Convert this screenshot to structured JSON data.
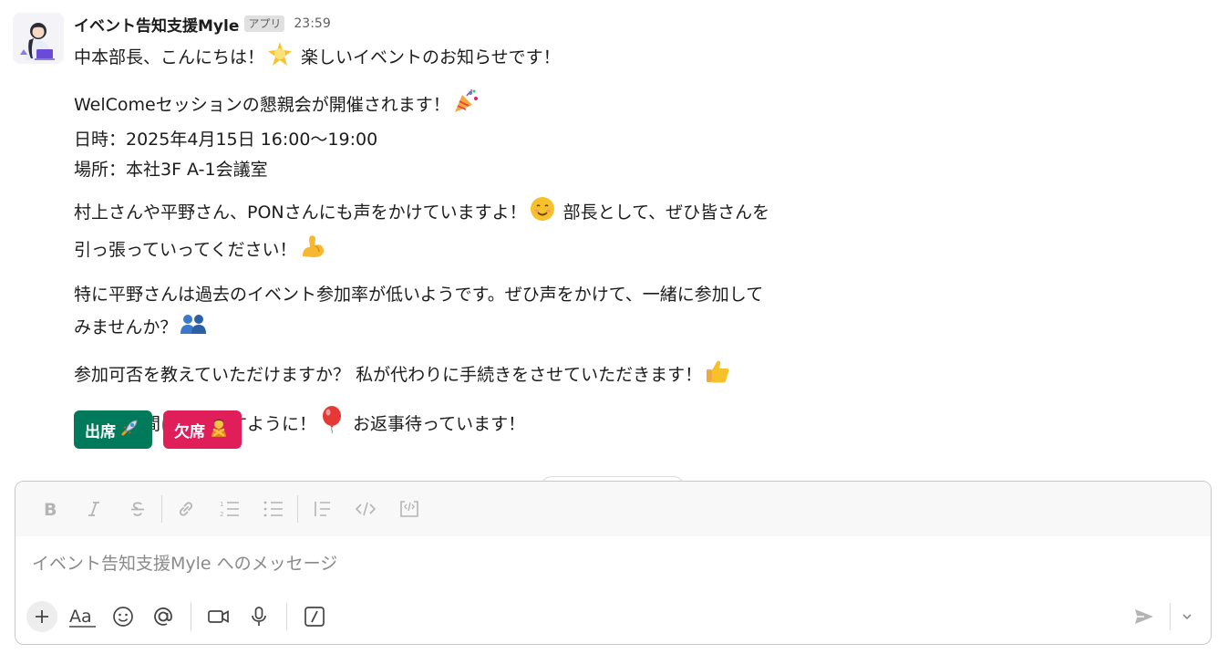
{
  "message": {
    "sender": "イベント告知支援Myle",
    "badge": "アプリ",
    "time": "23:59",
    "avatar_icon": "woman-with-laptop-avatar",
    "paragraphs": [
      {
        "lines": [
          {
            "pre": "中本部長、こんにちは！",
            "emoji": "glowing-star-emoji",
            "post": " 楽しいイベントのお知らせです！"
          }
        ]
      },
      {
        "lines": [
          {
            "pre": "WelComeセッションの懇親会が開催されます！",
            "emoji": "party-popper-emoji",
            "post": ""
          },
          {
            "pre": "日時：2025年4月15日 16:00〜19:00",
            "emoji": "",
            "post": ""
          },
          {
            "pre": "場所：本社3F A-1会議室",
            "emoji": "",
            "post": ""
          }
        ]
      },
      {
        "lines": [
          {
            "pre": "村上さんや平野さん、PONさんにも声をかけていますよ！",
            "emoji": "smiling-face-emoji",
            "post": " 部長として、ぜひ皆さんを"
          },
          {
            "pre": "引っ張っていってください！",
            "emoji": "flexed-biceps-emoji",
            "post": ""
          }
        ]
      },
      {
        "lines": [
          {
            "pre": "特に平野さんは過去のイベント参加率が低いようです。ぜひ声をかけて、一緒に参加して",
            "emoji": "",
            "post": ""
          },
          {
            "pre": "みませんか？",
            "emoji": "two-people-emoji",
            "post": ""
          }
        ]
      },
      {
        "lines": [
          {
            "pre": "参加可否を教えていただけますか？ 私が代わりに手続きをさせていただきます！",
            "emoji": "thumbs-up-emoji",
            "post": ""
          }
        ]
      },
      {
        "lines": [
          {
            "pre": "楽しい時間になりますように！",
            "emoji": "balloon-emoji",
            "post": " お返事待っています！"
          }
        ]
      }
    ],
    "buttons": [
      {
        "label": "出席",
        "emoji": "rocket-emoji",
        "color": "#007a5a"
      },
      {
        "label": "欠席",
        "emoji": "person-gesturing-no-emoji",
        "color": "#e01e5a"
      }
    ]
  },
  "composer": {
    "placeholder": "イベント告知支援Myle へのメッセージ",
    "format_tools": [
      "bold-icon",
      "italic-icon",
      "strikethrough-icon",
      "link-icon",
      "ordered-list-icon",
      "bulleted-list-icon",
      "blockquote-icon",
      "code-icon",
      "code-block-icon"
    ],
    "bottom_tools": [
      "plus-icon",
      "text-format-icon",
      "emoji-icon",
      "mention-icon",
      "video-icon",
      "microphone-icon",
      "slash-command-icon",
      "send-icon",
      "chevron-down-icon"
    ]
  },
  "colors": {
    "attend_button": "#007a5a",
    "decline_button": "#e01e5a",
    "badge_bg": "#e0e0e0",
    "toolbar_icon": "#b4b4b4"
  }
}
